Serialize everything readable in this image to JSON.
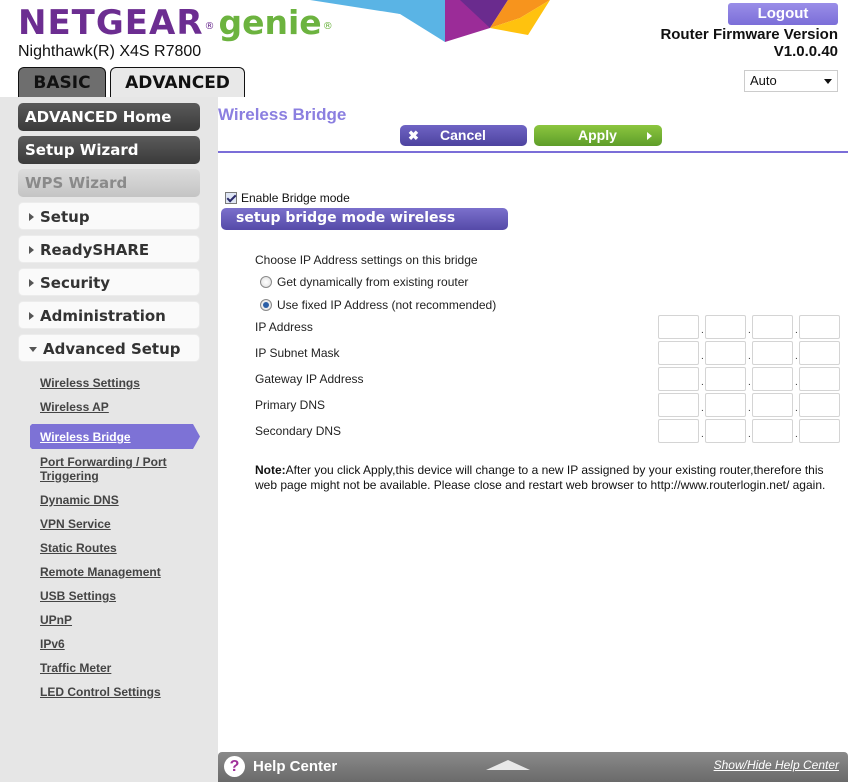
{
  "header": {
    "brand": "NETGEAR",
    "brand_reg": "®",
    "product": "genie",
    "product_reg": "®",
    "model": "Nighthawk(R) X4S R7800",
    "logout_label": "Logout",
    "firmware_label": "Router Firmware Version",
    "firmware_version": "V1.0.0.40",
    "language_select": {
      "selected": "Auto"
    },
    "tabs": [
      {
        "label": "BASIC",
        "active": false
      },
      {
        "label": "ADVANCED",
        "active": true
      }
    ],
    "colors": {
      "brand": "#6c2d91",
      "product": "#6cb33f",
      "accent": "#7b6ed8"
    }
  },
  "sidebar": {
    "main_buttons": [
      {
        "label": "ADVANCED Home",
        "style": "dark"
      },
      {
        "label": "Setup Wizard",
        "style": "dark"
      },
      {
        "label": "WPS Wizard",
        "style": "disabled"
      }
    ],
    "sections": [
      {
        "label": "Setup",
        "expanded": false
      },
      {
        "label": "ReadySHARE",
        "expanded": false
      },
      {
        "label": "Security",
        "expanded": false
      },
      {
        "label": "Administration",
        "expanded": false
      },
      {
        "label": "Advanced Setup",
        "expanded": true
      }
    ],
    "sub_items": [
      {
        "label": "Wireless Settings",
        "active": false
      },
      {
        "label": "Wireless AP",
        "active": false
      },
      {
        "label": "Wireless Bridge",
        "active": true
      },
      {
        "label": "Port Forwarding / Port",
        "label2": "Triggering",
        "active": false
      },
      {
        "label": "Dynamic DNS",
        "active": false
      },
      {
        "label": "VPN Service",
        "active": false
      },
      {
        "label": "Static Routes",
        "active": false
      },
      {
        "label": "Remote Management",
        "active": false
      },
      {
        "label": "USB Settings",
        "active": false
      },
      {
        "label": "UPnP",
        "active": false
      },
      {
        "label": "IPv6",
        "active": false
      },
      {
        "label": "Traffic Meter",
        "active": false
      },
      {
        "label": "LED Control Settings",
        "active": false
      }
    ]
  },
  "main": {
    "title": "Wireless Bridge",
    "cancel_label": "Cancel",
    "apply_label": "Apply",
    "enable_bridge": {
      "label": "Enable Bridge mode",
      "checked": true
    },
    "setup_bridge_button": "setup bridge mode wireless settings",
    "ip_settings_label": "Choose IP Address settings on this bridge",
    "ip_options": [
      {
        "label": "Get dynamically from existing router",
        "checked": false
      },
      {
        "label": "Use fixed IP Address (not recommended)",
        "checked": true
      }
    ],
    "ip_fields": [
      {
        "label": "IP Address",
        "octets": [
          "",
          "",
          "",
          ""
        ]
      },
      {
        "label": "IP Subnet Mask",
        "octets": [
          "",
          "",
          "",
          ""
        ]
      },
      {
        "label": "Gateway IP Address",
        "octets": [
          "",
          "",
          "",
          ""
        ]
      },
      {
        "label": "Primary DNS",
        "octets": [
          "",
          "",
          "",
          ""
        ]
      },
      {
        "label": "Secondary DNS",
        "octets": [
          "",
          "",
          "",
          ""
        ]
      }
    ],
    "note_prefix": "Note:",
    "note_text": "After you click Apply,this device will change to a new IP assigned by your existing router,therefore this web page might not be available. Please close and restart web browser to http://www.routerlogin.net/ again."
  },
  "help_bar": {
    "icon": "question-icon",
    "title": "Help Center",
    "toggle_link": "Show/Hide Help Center"
  }
}
